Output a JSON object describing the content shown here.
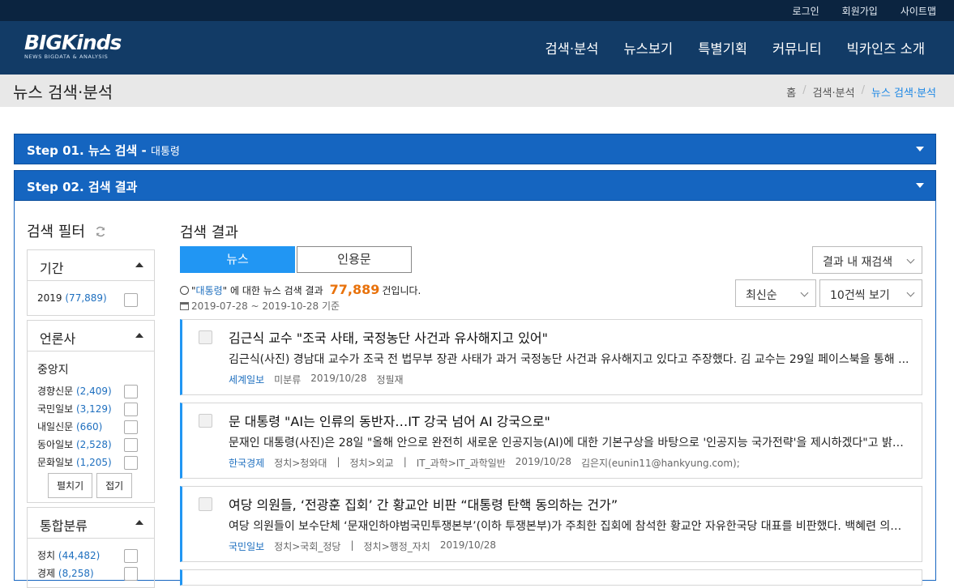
{
  "topbar": {
    "login": "로그인",
    "join": "회원가입",
    "sitemap": "사이트맵"
  },
  "header": {
    "logo_text": "BIGKinds",
    "logo_sub": "NEWS BIGDATA & ANALYSIS",
    "nav": [
      "검색·분석",
      "뉴스보기",
      "특별기획",
      "커뮤니티",
      "빅카인즈 소개"
    ]
  },
  "page": {
    "title": "뉴스 검색·분석",
    "breadcrumb": [
      "홈",
      "검색·분석",
      "뉴스 검색·분석"
    ]
  },
  "steps": {
    "step1_label": "Step 01. 뉴스 검색 - ",
    "step1_keyword": "대통령",
    "step2_label": "Step 02. 검색 결과"
  },
  "filter": {
    "title": "검색 필터",
    "period": {
      "label": "기간",
      "items": [
        {
          "name": "2019",
          "count": "(77,889)"
        }
      ]
    },
    "press": {
      "label": "언론사",
      "group": "중앙지",
      "items": [
        {
          "name": "경향신문",
          "count": "(2,409)"
        },
        {
          "name": "국민일보",
          "count": "(3,129)"
        },
        {
          "name": "내일신문",
          "count": "(660)"
        },
        {
          "name": "동아일보",
          "count": "(2,528)"
        },
        {
          "name": "문화일보",
          "count": "(1,205)"
        }
      ],
      "expand": "펼치기",
      "collapse": "접기"
    },
    "category": {
      "label": "통합분류",
      "items": [
        {
          "name": "정치",
          "count": "(44,482)"
        },
        {
          "name": "경제",
          "count": "(8,258)"
        }
      ]
    }
  },
  "results": {
    "title": "검색 결과",
    "tabs": [
      "뉴스",
      "인용문"
    ],
    "research": "결과 내 재검색",
    "sort": "최신순",
    "per_page": "10건씩 보기",
    "summary_prefix": "\"",
    "summary_keyword": "대통령",
    "summary_mid": "\" 에 대한 뉴스 검색 결과",
    "summary_count": "77,889",
    "summary_suffix": "건입니다.",
    "period_text": "2019-07-28 ~ 2019-10-28 기준",
    "articles": [
      {
        "title": "김근식 교수 \"조국 사태, 국정농단 사건과 유사해지고 있어\"",
        "body": "김근식(사진) 경남대 교수가 조국 전 법무부 장관 사태가 과거 국정농단 사건과 유사해지고 있다고 주장했다. 김 교수는 29일 페이스북을 통해 ...",
        "press": "세계일보",
        "meta": [
          "미분류",
          "2019/10/28",
          "정필재"
        ]
      },
      {
        "title": "문 대통령 \"AI는 인류의 동반자…IT 강국 넘어 AI 강국으로\"",
        "body": "문재인 대통령(사진)은 28일 \"올해 안으로 완전히 새로운 인공지능(AI)에 대한 기본구상을 바탕으로 '인공지능 국가전략'을 제시하겠다\"고 밝혔다.",
        "press": "한국경제",
        "meta": [
          "정치>청와대",
          "|",
          "정치>외교",
          "|",
          "IT_과학>IT_과학일반",
          "2019/10/28",
          "김은지(eunin11@hankyung.com);"
        ]
      },
      {
        "title": "여당 의원들, ‘전광훈 집회’ 간 황교안 비판 “대통령 탄핵 동의하는 건가”",
        "body": "여당 의원들이 보수단체 ‘문재인하야범국민투쟁본부’(이하 투쟁본부)가 주최한 집회에 참석한 황교안 자유한국당 대표를 비판했다. 백혜련 의원은 ...",
        "press": "국민일보",
        "meta": [
          "정치>국회_정당",
          "|",
          "정치>행정_자치",
          "2019/10/28"
        ]
      }
    ]
  }
}
